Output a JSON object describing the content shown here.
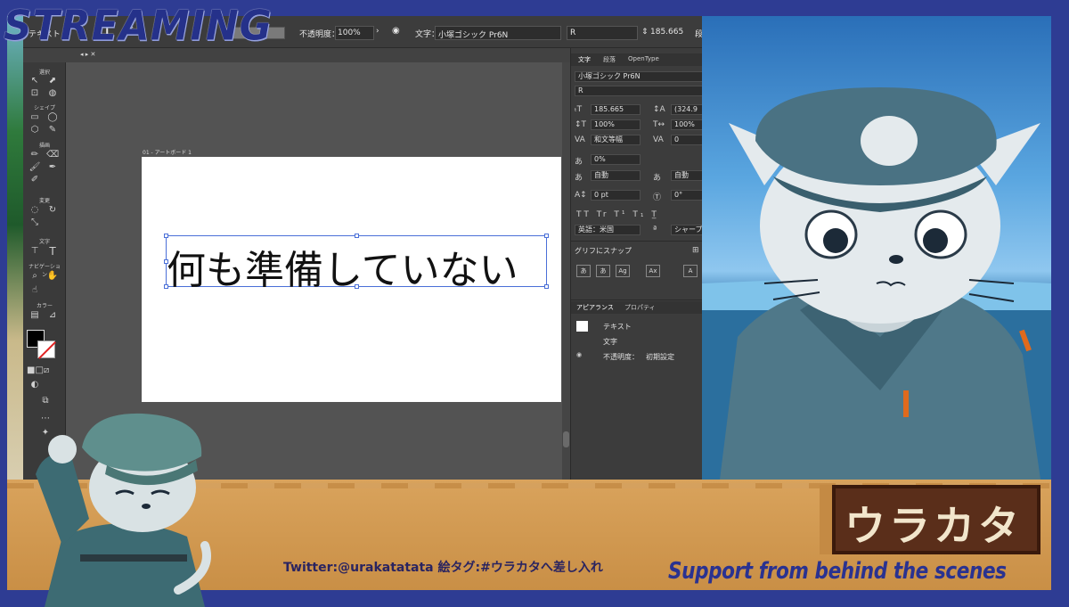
{
  "overlay": {
    "streaming_label": "STREAMING",
    "twitter_text": "Twitter:@urakatatata 絵タグ:#ウラカタへ差し入れ",
    "support_text": "Support from behind the scenes",
    "logo_text": "ウラカタ"
  },
  "control_bar": {
    "text_tool_label": "テキスト",
    "opacity_label": "不透明度：",
    "opacity_value": "100%",
    "font_label": "文字：",
    "font_name": "小塚ゴシック Pr6N",
    "font_style": "R",
    "font_size": "185.665",
    "trailing_label": "段"
  },
  "tools_panel": {
    "section_select": "選択",
    "section_shape": "シェイプ",
    "section_draw": "描画",
    "section_modify": "変更",
    "section_text": "文字",
    "section_navigate": "ナビゲーション",
    "section_color": "カラー"
  },
  "canvas": {
    "artboard_label": "01 - アートボード 1",
    "text_content": "何も準備していない"
  },
  "character_panel": {
    "tabs": [
      "文字",
      "段落",
      "OpenType"
    ],
    "font_name": "小塚ゴシック Pr6N",
    "font_style": "R",
    "size_value": "185.665",
    "leading_value": "(324.9",
    "vscale_value": "100%",
    "hscale_value": "100%",
    "kerning_value": "和文等幅",
    "tracking_value": "0",
    "tsume_value": "0%",
    "aki_left": "自動",
    "aki_right": "自動",
    "baseline_value": "0 pt",
    "rotation_value": "0°",
    "language_value": "英語：米国",
    "antialias_value": "シャープ",
    "snap_label": "グリフにスナップ"
  },
  "appearance_panel": {
    "tabs": [
      "アピアランス",
      "プロパティ"
    ],
    "item_text": "テキスト",
    "item_chars": "文字",
    "item_opacity_label": "不透明度：",
    "item_opacity_value": "初期設定"
  },
  "colors": {
    "frame": "#2e3c93",
    "banner": "#d9a35c",
    "logo_bg": "#5a2e1a",
    "selection": "#4a6fd8"
  }
}
